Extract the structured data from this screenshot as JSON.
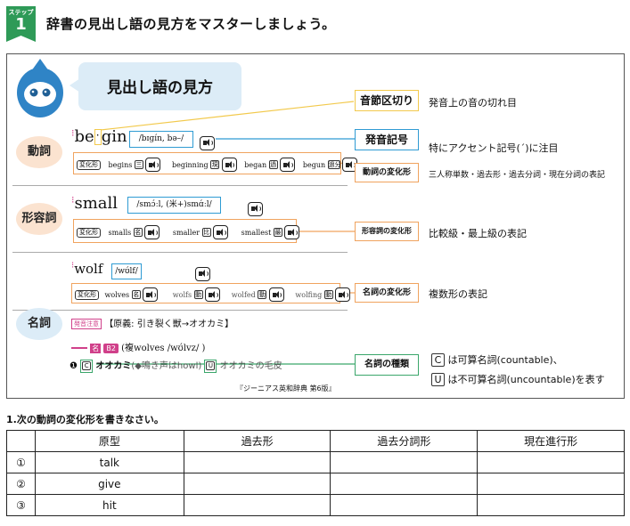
{
  "step": {
    "badge_label": "ステップ",
    "number": "1",
    "title": "辞書の見出し語の見方をマスターしましょう。"
  },
  "bubble_title": "見出し語の見方",
  "verb": {
    "category": "動詞",
    "headword_a": "be",
    "headword_b": "gin",
    "pron": "/bɪɡín, bə–/",
    "forms_tag": "変化形",
    "forms": [
      "begins",
      "beginning",
      "began",
      "begun"
    ],
    "form_marks": [
      "三",
      "現",
      "過",
      "過分"
    ]
  },
  "adj": {
    "category": "形容詞",
    "headword": "small",
    "pron": "/smɔ́ːl, (米+)smɑ́ːl/",
    "forms_tag": "変化形",
    "forms": [
      "smalls",
      "smaller",
      "smallest"
    ],
    "form_marks": [
      "名",
      "比",
      "最"
    ]
  },
  "noun": {
    "category": "名詞",
    "headword": "wolf",
    "pron": "/wʊ́lf/",
    "forms_tag": "変化形",
    "forms": [
      "wolves",
      "wolfs",
      "wolfed",
      "wolfing"
    ],
    "form_marks": [
      "名",
      "動",
      "動",
      "動"
    ],
    "origin_tag": "発音注意",
    "origin": "【原義: 引き裂く獣→オオカミ】",
    "entry_mark": "名",
    "level": "B2",
    "plural": "(複wolves /wʊ́lvz/ )",
    "sense_num": "❶",
    "sense_c": "C",
    "sense_main": "オオカミ",
    "sense_note": "(◆鳴き声はhowl)",
    "sense_u": "U",
    "sense_u_text": "オオカミの毛皮"
  },
  "source": "『ジーニアス英和辞典 第6版』",
  "annotations": {
    "syllable": {
      "label": "音節区切り",
      "desc": "発音上の音の切れ目"
    },
    "pron": {
      "label": "発音記号",
      "desc": "特にアクセント記号(´)に注目"
    },
    "verb_forms": {
      "label": "動詞の変化形",
      "desc": "三人称単数・過去形・過去分詞・現在分詞の表記"
    },
    "adj_forms": {
      "label": "形容詞の変化形",
      "desc": "比較級・最上級の表記"
    },
    "noun_forms": {
      "label": "名詞の変化形",
      "desc": "複数形の表記"
    },
    "noun_type": {
      "label": "名詞の種類",
      "c_mark": "C",
      "c_desc": "は可算名詞(countable)、",
      "u_mark": "U",
      "u_desc": "は不可算名詞(uncountable)を表す"
    }
  },
  "exercise": {
    "instruction": "1.次の動詞の変化形を書きなさい。",
    "headers": [
      "原型",
      "過去形",
      "過去分詞形",
      "現在進行形"
    ],
    "rows": [
      {
        "num": "①",
        "word": "talk"
      },
      {
        "num": "②",
        "word": "give"
      },
      {
        "num": "③",
        "word": "hit"
      }
    ]
  }
}
